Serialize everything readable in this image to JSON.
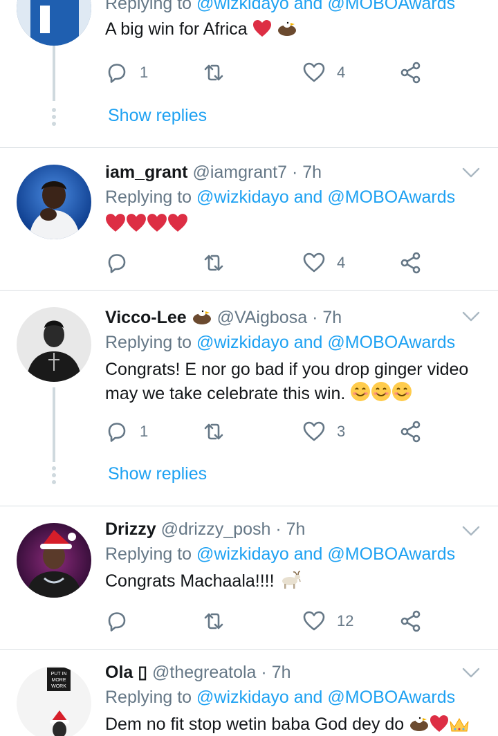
{
  "colors": {
    "accent": "#1da1f2",
    "muted": "#657786",
    "heart": "#e0245e"
  },
  "tweets": [
    {
      "display_name": "",
      "handle": "",
      "time": "",
      "replying_label": "Replying to",
      "mention1": "@wizkidayo",
      "and_label": "and",
      "mention2": "@MOBOAwards",
      "text": "A big win for Africa",
      "reply_count": "1",
      "like_count": "4",
      "show_replies": "Show replies"
    },
    {
      "display_name": "iam_grant",
      "handle": "@iamgrant7",
      "sep": "·",
      "time": "7h",
      "replying_label": "Replying to",
      "mention1": "@wizkidayo",
      "and_label": "and",
      "mention2": "@MOBOAwards",
      "text": "",
      "reply_count": "",
      "like_count": "4"
    },
    {
      "display_name": "Vicco-Lee",
      "handle": "@VAigbosa",
      "sep": "·",
      "time": "7h",
      "replying_label": "Replying to",
      "mention1": "@wizkidayo",
      "and_label": "and",
      "mention2": "@MOBOAwards",
      "text_line1": "Congrats! E nor go bad if you drop ginger video",
      "text_line2": "may we take celebrate this win.",
      "reply_count": "1",
      "like_count": "3",
      "show_replies": "Show replies"
    },
    {
      "display_name": "Drizzy",
      "handle": "@drizzy_posh",
      "sep": "·",
      "time": "7h",
      "replying_label": "Replying to",
      "mention1": "@wizkidayo",
      "and_label": "and",
      "mention2": "@MOBOAwards",
      "text": "Congrats Machaala!!!!",
      "reply_count": "",
      "like_count": "12"
    },
    {
      "display_name": "Ola",
      "name_glyph": "▯",
      "handle": "@thegreatola",
      "sep": "·",
      "time": "7h",
      "replying_label": "Replying to",
      "mention1": "@wizkidayo",
      "and_label": "and",
      "mention2": "@MOBOAwards",
      "text": "Dem no fit stop wetin baba God dey do",
      "avatar_sign": [
        "PUT IN",
        "MORE",
        "WORK"
      ]
    }
  ]
}
